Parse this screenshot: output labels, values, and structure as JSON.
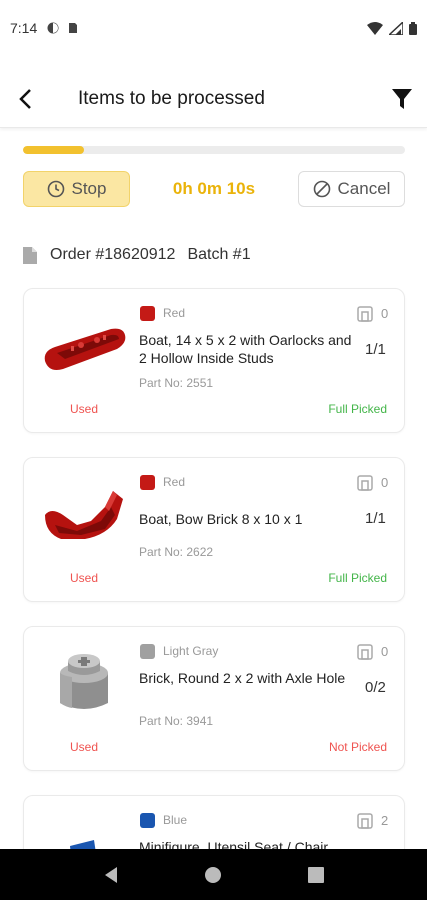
{
  "status_bar": {
    "time": "7:14"
  },
  "header": {
    "title": "Items to be processed"
  },
  "progress": {
    "fraction": 0.16,
    "color": "#f2c12e"
  },
  "controls": {
    "stop_label": "Stop",
    "timer": "0h 0m 10s",
    "cancel_label": "Cancel"
  },
  "order": {
    "number": "Order #18620912",
    "batch": "Batch #1"
  },
  "items": [
    {
      "color_name": "Red",
      "swatch": "#c41a16",
      "name": "Boat, 14 x 5 x 2 with Oarlocks and 2 Hollow Inside Studs",
      "part_no": "Part No: 2551",
      "condition": "Used",
      "store_count": "0",
      "qty": "1/1",
      "status": "Full Picked",
      "status_color": "#43b549",
      "icon": "red-boat-hull"
    },
    {
      "color_name": "Red",
      "swatch": "#c41a16",
      "name": "Boat, Bow Brick 8 x 10 x 1",
      "part_no": "Part No: 2622",
      "condition": "Used",
      "store_count": "0",
      "qty": "1/1",
      "status": "Full Picked",
      "status_color": "#43b549",
      "icon": "red-bow-brick"
    },
    {
      "color_name": "Light Gray",
      "swatch": "#a0a0a0",
      "name": "Brick, Round 2 x 2 with Axle Hole",
      "part_no": "Part No: 3941",
      "condition": "Used",
      "store_count": "0",
      "qty": "0/2",
      "status": "Not Picked",
      "status_color": "#ef5350",
      "icon": "gray-round-brick"
    },
    {
      "color_name": "Blue",
      "swatch": "#1a56b0",
      "name": "Minifigure, Utensil Seat / Chair",
      "store_count": "2",
      "icon": "blue-chair"
    }
  ]
}
